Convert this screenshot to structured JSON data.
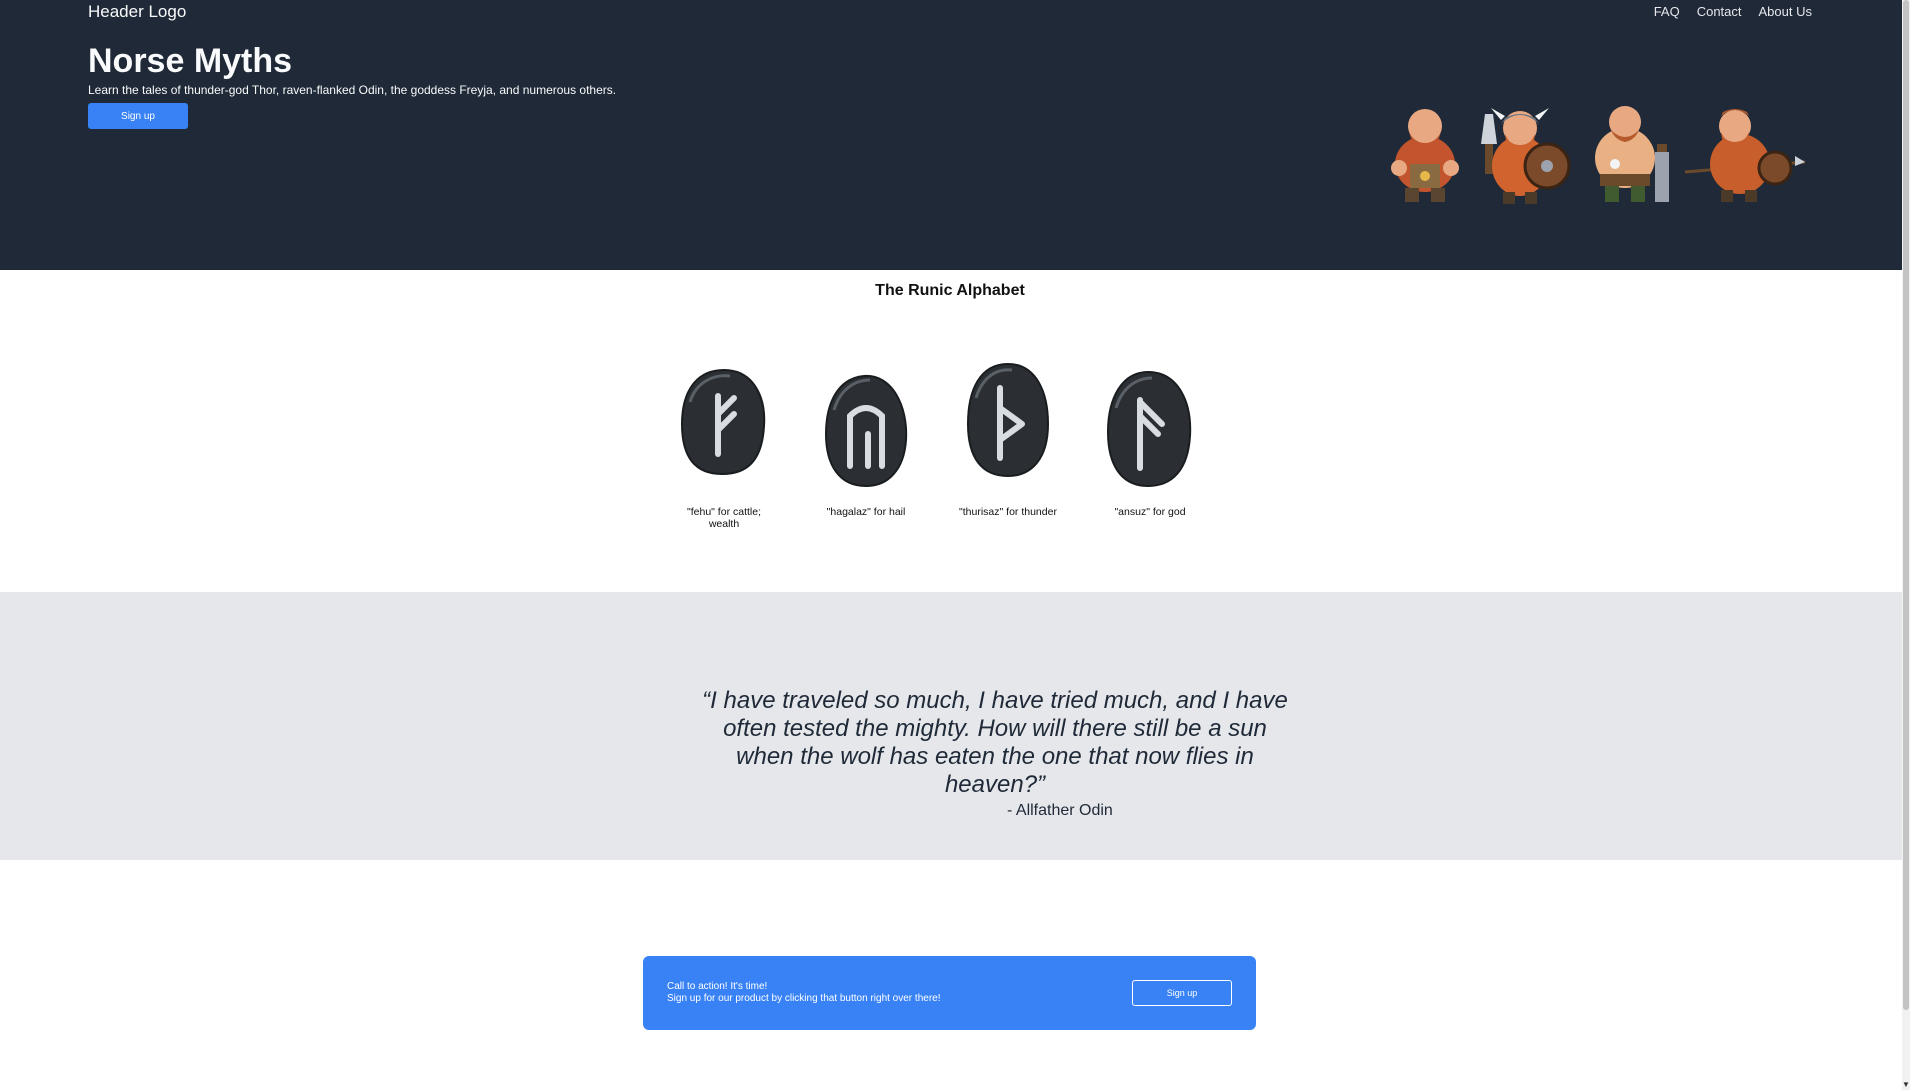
{
  "header": {
    "logo": "Header Logo",
    "nav": [
      "FAQ",
      "Contact",
      "About Us"
    ],
    "title": "Norse Myths",
    "subtitle": "Learn the tales of thunder-god Thor, raven-flanked Odin, the goddess Freyja, and numerous others.",
    "signup_label": "Sign up"
  },
  "runes": {
    "title": "The Runic Alphabet",
    "items": [
      {
        "caption": "\"fehu\" for cattle; wealth"
      },
      {
        "caption": "\"hagalaz\" for hail"
      },
      {
        "caption": "\"thurisaz\" for thunder"
      },
      {
        "caption": "\"ansuz\" for god"
      }
    ]
  },
  "quote": {
    "text": "“I have traveled so much, I have tried much, and I have often tested the mighty. How will there still be a sun when the wolf has eaten the one that now flies in heaven?”",
    "author": "- Allfather Odin"
  },
  "cta": {
    "title": "Call to action! It's time!",
    "text": "Sign up for our product by clicking that button right over there!",
    "button_label": "Sign up"
  },
  "colors": {
    "header_bg": "#1f2937",
    "accent": "#3882f6",
    "quote_bg": "#e5e7eb"
  }
}
